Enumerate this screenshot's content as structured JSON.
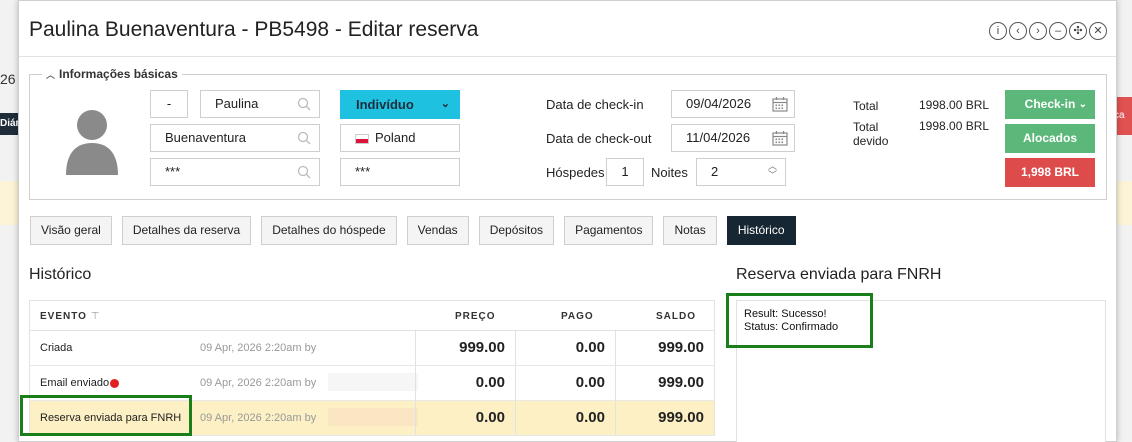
{
  "background": {
    "left_number": "26",
    "left_tag": "Diári",
    "right_tag": "ca"
  },
  "modal": {
    "title": "Paulina Buenaventura - PB5498 - Editar reserva",
    "header_icons": [
      "info-icon",
      "chevron-left-icon",
      "chevron-right-icon",
      "minus-icon",
      "expand-icon",
      "close-icon"
    ]
  },
  "basic_info": {
    "legend": "Informações básicas",
    "title_field": "-",
    "first_name": "Paulina",
    "last_name": "Buenaventura",
    "field_3": "***",
    "type": "Indivíduo",
    "country": "Poland",
    "field_6": "***",
    "checkin_label": "Data de check-in",
    "checkin_value": "09/04/2026",
    "checkout_label": "Data de check-out",
    "checkout_value": "11/04/2026",
    "guests_label": "Hóspedes",
    "guests_value": "1",
    "nights_label": "Noites",
    "nights_value": "2",
    "total_label": "Total",
    "total_value": "1998.00 BRL",
    "total_due_label_1": "Total",
    "total_due_label_2": "devido",
    "total_due_value": "1998.00 BRL",
    "btn_checkin": "Check-in",
    "btn_allocated": "Alocados",
    "btn_balance": "1,998 BRL"
  },
  "tabs": [
    {
      "label": "Visão geral"
    },
    {
      "label": "Detalhes da reserva"
    },
    {
      "label": "Detalhes do hóspede"
    },
    {
      "label": "Vendas"
    },
    {
      "label": "Depósitos"
    },
    {
      "label": "Pagamentos"
    },
    {
      "label": "Notas"
    },
    {
      "label": "Histórico"
    }
  ],
  "history": {
    "title": "Histórico",
    "columns": {
      "event": "EVENTO",
      "price": "PREÇO",
      "paid": "PAGO",
      "balance": "SALDO"
    },
    "rows": [
      {
        "event": "Criada",
        "date": "09 Apr, 2026 2:20am by",
        "price": "999.00",
        "paid": "0.00",
        "balance": "999.00"
      },
      {
        "event": "Email enviado",
        "date": "09 Apr, 2026 2:20am by",
        "price": "0.00",
        "paid": "0.00",
        "balance": "999.00"
      },
      {
        "event": "Reserva enviada para FNRH",
        "date": "09 Apr, 2026 2:20am by",
        "price": "0.00",
        "paid": "0.00",
        "balance": "999.00"
      }
    ]
  },
  "detail": {
    "title": "Reserva enviada para FNRH",
    "line_1": "Result: Sucesso!",
    "line_2": "Status: Confirmado"
  },
  "colors": {
    "accent_cyan": "#1fc1e0",
    "checkin_green": "#5cb87a",
    "balance_red": "#dd4b4b",
    "active_tab": "#172633",
    "highlight_row": "#fdf0c4",
    "annotation_green": "#1a7f1a"
  }
}
